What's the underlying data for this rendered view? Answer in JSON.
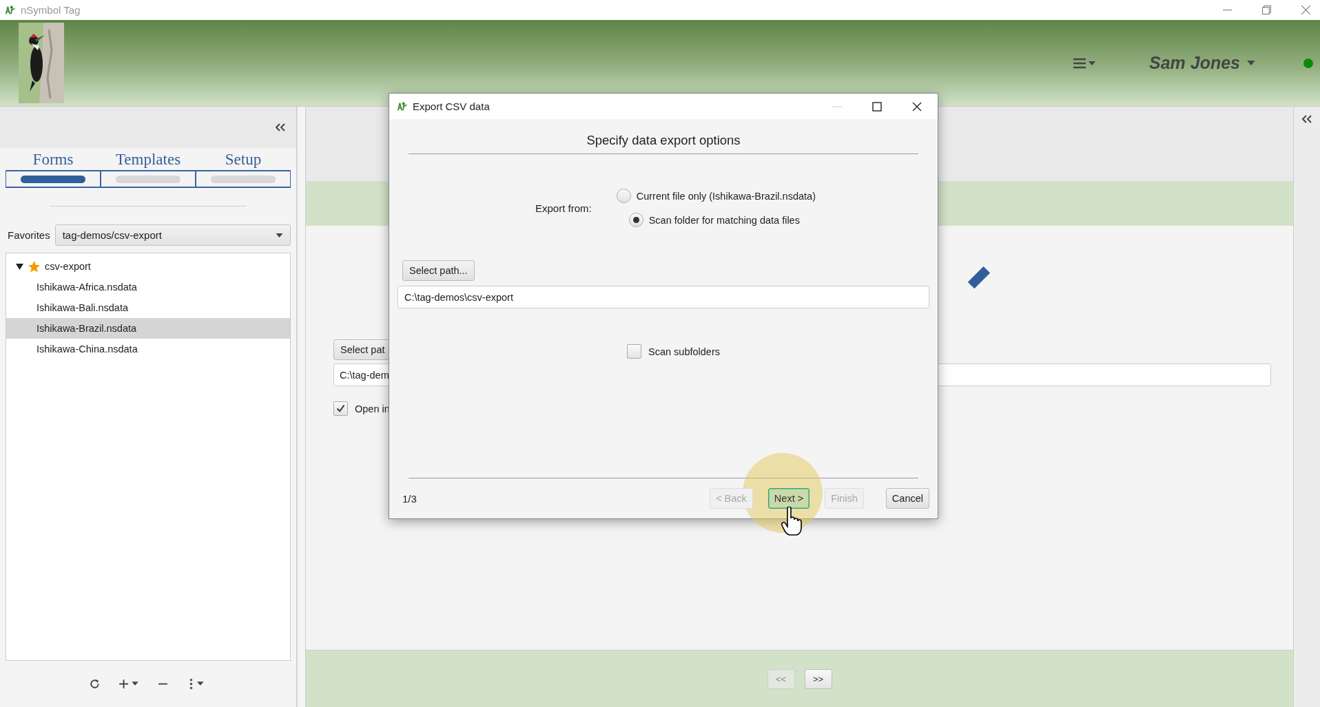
{
  "app": {
    "title": "nSymbol Tag",
    "user": "Sam Jones"
  },
  "sidebar": {
    "tabs": [
      {
        "label": "Forms",
        "selected": true
      },
      {
        "label": "Templates",
        "selected": false
      },
      {
        "label": "Setup",
        "selected": false
      }
    ],
    "favorites": {
      "label": "Favorites",
      "value": "tag-demos/csv-export"
    },
    "tree": [
      {
        "label": "csv-export",
        "expanded": true,
        "starred": true,
        "selected": false,
        "children": [
          {
            "label": "Ishikawa-Africa.nsdata",
            "selected": false
          },
          {
            "label": "Ishikawa-Bali.nsdata",
            "selected": false
          },
          {
            "label": "Ishikawa-Brazil.nsdata",
            "selected": true
          },
          {
            "label": "Ishikawa-China.nsdata",
            "selected": false
          }
        ]
      }
    ]
  },
  "main": {
    "select_path_button": "Select pat",
    "path_field": "C:\\tag-dem",
    "open_checkbox": {
      "label": "Open in",
      "checked": true
    },
    "pager": [
      {
        "label": "<<",
        "disabled": true
      },
      {
        "label": ">>",
        "disabled": false
      }
    ]
  },
  "dialog": {
    "title": "Export CSV data",
    "heading": "Specify data export options",
    "export_from_label": "Export from:",
    "options": [
      {
        "label": "Current file only (Ishikawa-Brazil.nsdata)",
        "selected": false
      },
      {
        "label": "Scan folder for matching data files",
        "selected": true
      }
    ],
    "select_path_button": "Select path...",
    "path_value": "C:\\tag-demos\\csv-export",
    "scan_subfolders": {
      "label": "Scan subfolders",
      "checked": false
    },
    "step": "1/3",
    "buttons": [
      {
        "label": "< Back",
        "disabled": true,
        "default": false
      },
      {
        "label": "Next >",
        "disabled": false,
        "default": true
      },
      {
        "label": "Finish",
        "disabled": true,
        "default": false
      },
      {
        "label": "Cancel",
        "disabled": false,
        "default": false
      }
    ]
  }
}
